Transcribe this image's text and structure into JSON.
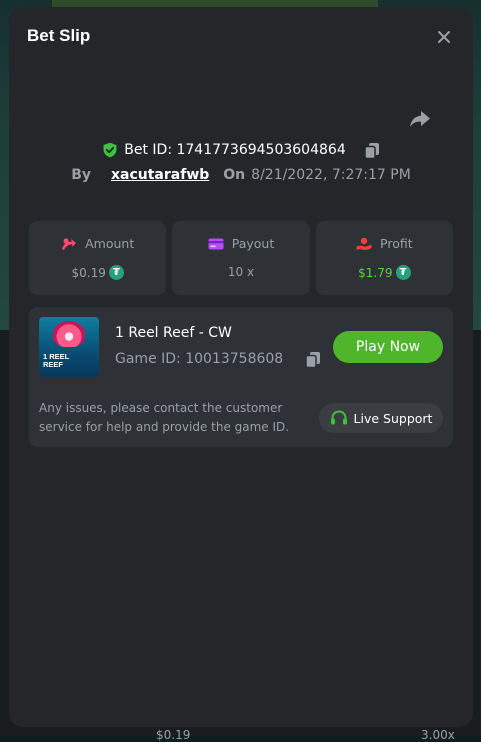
{
  "modal": {
    "title": "Bet Slip"
  },
  "bet": {
    "label_prefix": "Bet ID: ",
    "id": "1741773694503604864",
    "by_label": "By",
    "username": "xacutarafwb",
    "on_label": "On",
    "date": "8/21/2022, 7:27:17 PM"
  },
  "stats": [
    {
      "label": "Amount",
      "value": "$0.19",
      "icon": "amount-icon",
      "color": "#ff4d6d"
    },
    {
      "label": "Payout",
      "value": "10 x",
      "icon": "payout-card-icon",
      "color": "#b44dff"
    },
    {
      "label": "Profit",
      "value": "$1.79",
      "icon": "profit-icon",
      "color": "#ff3b3b"
    }
  ],
  "game": {
    "name": "1 Reel Reef - CW",
    "id_label": "Game ID: ",
    "id": "10013758608",
    "play_label": "Play Now",
    "thumb_text_line1": "1 REEL",
    "thumb_text_line2": "REEF",
    "issues_text": "Any issues, please contact the customer service for help and provide the game ID.",
    "support_label": "Live Support"
  },
  "background": {
    "amount": "$0.19",
    "multiplier": "3.00x"
  },
  "colors": {
    "accent_green": "#4fb62b",
    "profit_green": "#5fd23b",
    "coin": "#27a17a"
  }
}
